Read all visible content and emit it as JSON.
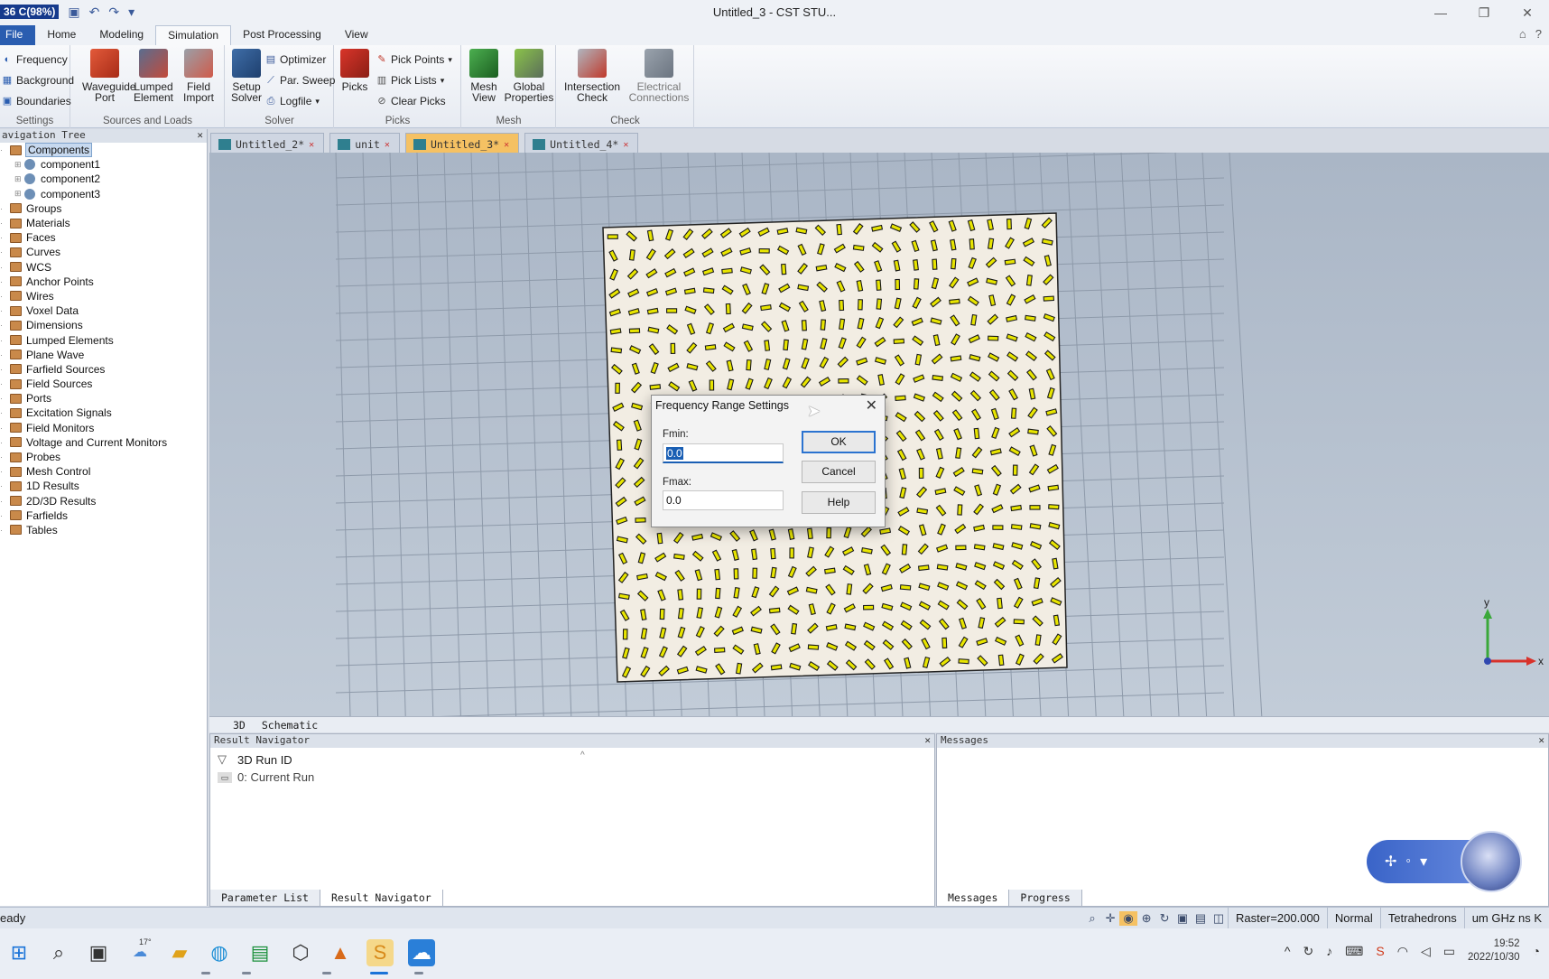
{
  "window": {
    "title": "Untitled_3 - CST STU...",
    "perf_counter": "36 C(98%)"
  },
  "ribbon_tabs": [
    "File",
    "Home",
    "Modeling",
    "Simulation",
    "Post Processing",
    "View"
  ],
  "ribbon": {
    "settings": {
      "items": [
        "Frequency",
        "Background",
        "Boundaries"
      ],
      "label": "Settings"
    },
    "sources": {
      "waveguide_port": "Waveguide Port",
      "lumped_element": "Lumped Element",
      "field_import": "Field Import",
      "label": "Sources and Loads"
    },
    "solver": {
      "setup_solver": "Setup Solver",
      "optimizer": "Optimizer",
      "par_sweep": "Par. Sweep",
      "logfile": "Logfile",
      "label": "Solver"
    },
    "picks": {
      "picks": "Picks",
      "pick_points": "Pick Points",
      "pick_lists": "Pick Lists",
      "clear_picks": "Clear Picks",
      "label": "Picks"
    },
    "mesh": {
      "mesh_view": "Mesh View",
      "global_properties": "Global Properties",
      "label": "Mesh"
    },
    "check": {
      "intersection_check": "Intersection Check",
      "electrical_connections": "Electrical Connections",
      "label": "Check"
    }
  },
  "nav_tree": {
    "header": "avigation Tree",
    "items": [
      {
        "label": "Components",
        "kind": "folder",
        "selected": true
      },
      {
        "label": "component1",
        "kind": "component"
      },
      {
        "label": "component2",
        "kind": "component"
      },
      {
        "label": "component3",
        "kind": "component"
      },
      {
        "label": "Groups",
        "kind": "folder"
      },
      {
        "label": "Materials",
        "kind": "folder"
      },
      {
        "label": "Faces",
        "kind": "folder"
      },
      {
        "label": "Curves",
        "kind": "folder"
      },
      {
        "label": "WCS",
        "kind": "folder"
      },
      {
        "label": "Anchor Points",
        "kind": "folder"
      },
      {
        "label": "Wires",
        "kind": "folder"
      },
      {
        "label": "Voxel Data",
        "kind": "folder"
      },
      {
        "label": "Dimensions",
        "kind": "folder"
      },
      {
        "label": "Lumped Elements",
        "kind": "folder"
      },
      {
        "label": "Plane Wave",
        "kind": "folder"
      },
      {
        "label": "Farfield Sources",
        "kind": "folder"
      },
      {
        "label": "Field Sources",
        "kind": "folder"
      },
      {
        "label": "Ports",
        "kind": "folder"
      },
      {
        "label": "Excitation Signals",
        "kind": "folder"
      },
      {
        "label": "Field Monitors",
        "kind": "folder"
      },
      {
        "label": "Voltage and Current Monitors",
        "kind": "folder"
      },
      {
        "label": "Probes",
        "kind": "folder"
      },
      {
        "label": "Mesh Control",
        "kind": "folder"
      },
      {
        "label": "1D Results",
        "kind": "folder"
      },
      {
        "label": "2D/3D Results",
        "kind": "folder"
      },
      {
        "label": "Farfields",
        "kind": "folder"
      },
      {
        "label": "Tables",
        "kind": "folder"
      }
    ]
  },
  "doc_tabs": [
    {
      "label": "Untitled_2*",
      "active": false
    },
    {
      "label": "unit",
      "active": false
    },
    {
      "label": "Untitled_3*",
      "active": true
    },
    {
      "label": "Untitled_4*",
      "active": false
    }
  ],
  "view_tabs": [
    "3D",
    "Schematic"
  ],
  "axes": {
    "x": "x",
    "y": "y"
  },
  "result_navigator": {
    "header": "Result Navigator",
    "run_id_label": "3D Run ID",
    "current_run": "0: Current Run",
    "tabs": [
      "Parameter List",
      "Result Navigator"
    ]
  },
  "messages": {
    "header": "Messages",
    "tabs": [
      "Messages",
      "Progress"
    ]
  },
  "status": {
    "ready": "eady",
    "raster": "Raster=200.000",
    "mode": "Normal",
    "mesh_type": "Tetrahedrons",
    "units": "um GHz ns K"
  },
  "dialog": {
    "title": "Frequency Range Settings",
    "fmin_label": "Fmin:",
    "fmin_value": "0.0",
    "fmax_label": "Fmax:",
    "fmax_value": "0.0",
    "ok": "OK",
    "cancel": "Cancel",
    "help": "Help"
  },
  "taskbar": {
    "weather": "17°",
    "time": "19:52",
    "date": "2022/10/30"
  },
  "colors": {
    "accent": "#2a5db0",
    "active_doc_tab": "#f5c163",
    "metasurface_bg": "#f2ede3",
    "element_fill": "#e8e500"
  }
}
